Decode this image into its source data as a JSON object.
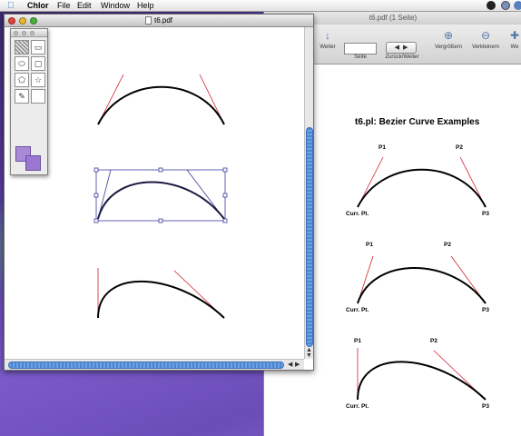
{
  "menubar": {
    "app_name": "Chlor",
    "items": [
      "File",
      "Edit",
      "Window",
      "Help"
    ]
  },
  "chlor_window": {
    "title": "t6.pdf"
  },
  "preview_window": {
    "title": "t6.pdf (1 Seite)",
    "toolbar": {
      "weiter": "Weiter",
      "seite": "Seite",
      "back_forward": "Zurück/Weiter",
      "zoom_in": "Vergrößern",
      "zoom_out": "Verkleinern",
      "more": "We"
    },
    "document": {
      "title": "t6.pl:  Bezier Curve Examples",
      "labels": {
        "p1": "P1",
        "p2": "P2",
        "p3": "P3",
        "current_point": "Curr. Pt."
      }
    }
  },
  "colors": {
    "selection": "#3a3aa0",
    "control_line": "#d02030",
    "desktop": "#5a3ea8"
  }
}
